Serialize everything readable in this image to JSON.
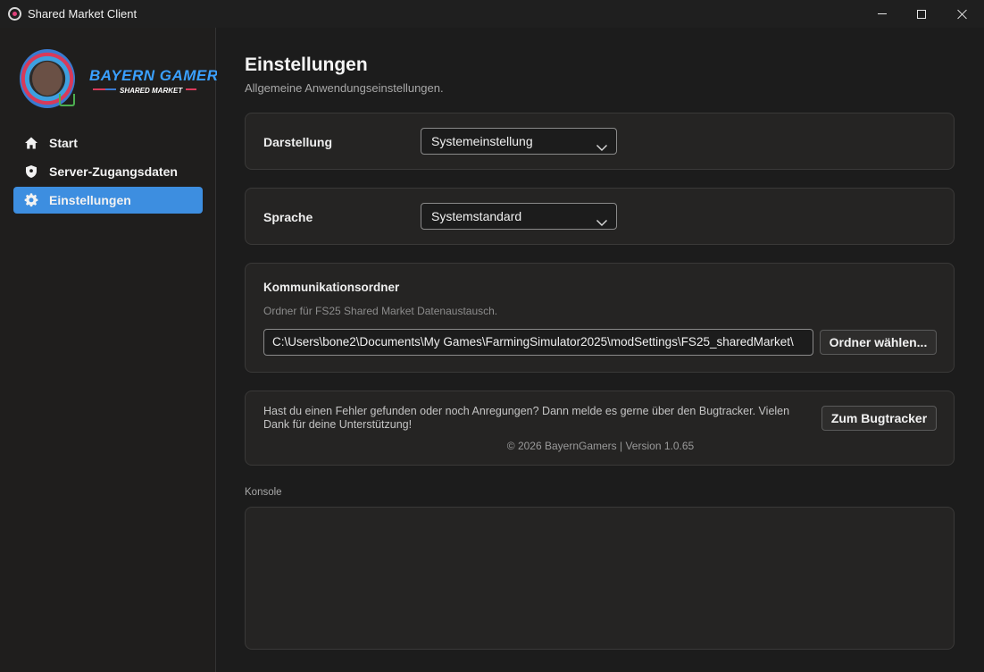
{
  "window": {
    "title": "Shared Market Client"
  },
  "logo": {
    "title": "BAYERN GAMERS",
    "subtitle": "SHARED MARKET"
  },
  "sidebar": {
    "items": [
      {
        "label": "Start",
        "icon": "home-icon"
      },
      {
        "label": "Server-Zugangsdaten",
        "icon": "shield-icon"
      },
      {
        "label": "Einstellungen",
        "icon": "gear-icon",
        "active": true
      }
    ]
  },
  "page": {
    "title": "Einstellungen",
    "subtitle": "Allgemeine Anwendungseinstellungen."
  },
  "appearance": {
    "label": "Darstellung",
    "value": "Systemeinstellung"
  },
  "language": {
    "label": "Sprache",
    "value": "Systemstandard"
  },
  "folder": {
    "label": "Kommunikationsordner",
    "description": "Ordner für FS25 Shared Market Datenaustausch.",
    "path": "C:\\Users\\bone2\\Documents\\My Games\\FarmingSimulator2025\\modSettings\\FS25_sharedMarket\\",
    "button": "Ordner wählen..."
  },
  "bugtracker": {
    "text": "Hast du einen Fehler gefunden oder noch Anregungen? Dann melde es gerne über den Bugtracker. Vielen Dank für deine Unterstützung!",
    "button": "Zum Bugtracker",
    "copyright": "© 2026 BayernGamers | Version 1.0.65"
  },
  "console": {
    "label": "Konsole"
  },
  "colors": {
    "accent": "#3d8ee0",
    "background": "#1c1c1c",
    "card": "#252423"
  }
}
